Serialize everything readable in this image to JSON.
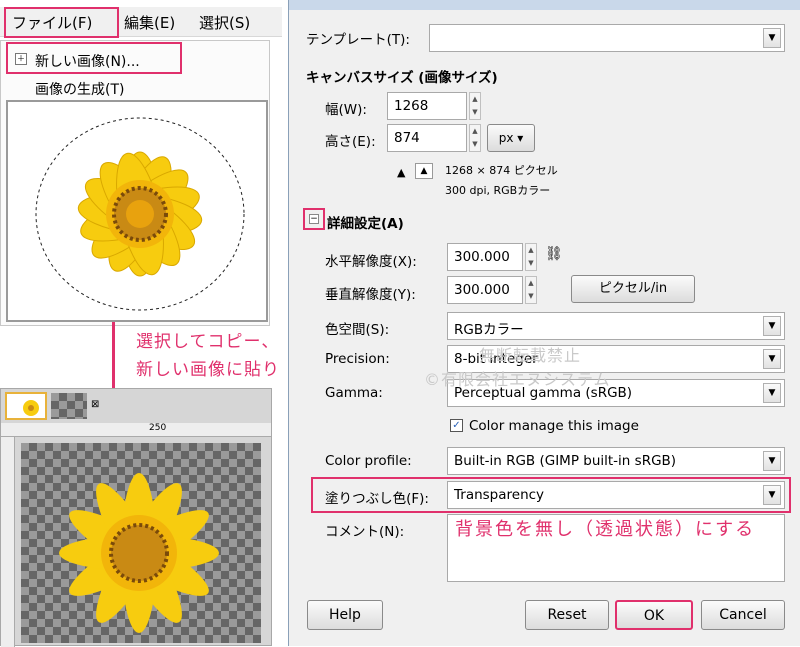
{
  "menu": {
    "file": "ファイル(F)",
    "file_mnemonic": "F",
    "edit": "編集(E)",
    "select": "選択(S)",
    "items": [
      "新しい画像(N)...",
      "画像の生成(T)"
    ]
  },
  "annotation_left": "選択してコピー、新しい画像に貼り付け",
  "canvas_window": {
    "ruler_mark": "250"
  },
  "dialog": {
    "template_label": "テンプレート(T):",
    "template_value": "",
    "canvas_size_heading": "キャンバスサイズ (画像サイズ)",
    "width_label": "幅(W):",
    "width_value": "1268",
    "height_label": "高さ(E):",
    "height_value": "874",
    "unit": "px",
    "size_info": "1268 × 874 ピクセル",
    "dpi_info": "300 dpi, RGBカラー",
    "advanced_heading": "詳細設定(A)",
    "x_res_label": "水平解像度(X):",
    "x_res_value": "300.000",
    "y_res_label": "垂直解像度(Y):",
    "y_res_value": "300.000",
    "res_unit": "ピクセル/in",
    "colorspace_label": "色空間(S):",
    "colorspace_value": "RGBカラー",
    "precision_label": "Precision:",
    "precision_value": "8-bit integer",
    "gamma_label": "Gamma:",
    "gamma_value": "Perceptual gamma (sRGB)",
    "color_manage_label": "Color manage this image",
    "color_profile_label": "Color profile:",
    "color_profile_value": "Built-in RGB (GIMP built-in sRGB)",
    "fill_label": "塗りつぶし色(F):",
    "fill_value": "Transparency",
    "comment_label": "コメント(N):",
    "comment_annotation": "背景色を無し（透過状態）にする",
    "watermark_1": "無断転載禁止",
    "watermark_2": "©有限会社エヌシステム",
    "help_button": "Help",
    "reset_button": "Reset",
    "ok_button": "OK",
    "cancel_button": "Cancel"
  },
  "colors": {
    "highlight": "#e0306c",
    "flower_petal": "#f7cc0f",
    "flower_center": "#c98a14"
  }
}
